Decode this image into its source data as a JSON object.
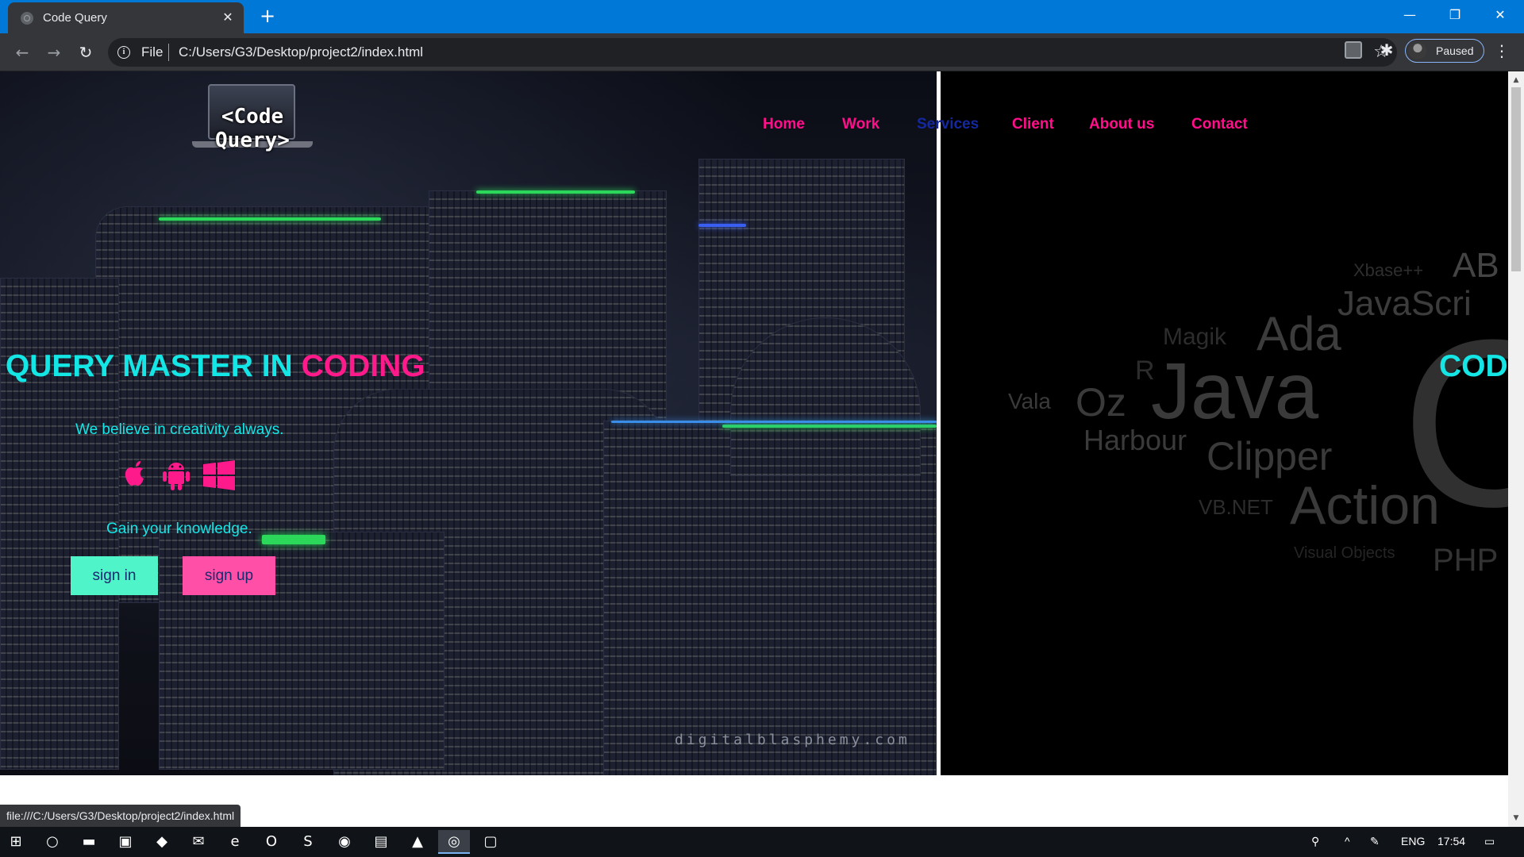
{
  "browser": {
    "tab_title": "Code Query",
    "url_scheme": "File",
    "url": "C:/Users/G3/Desktop/project2/index.html",
    "profile_label": "Paused",
    "status_url": "file:///C:/Users/G3/Desktop/project2/index.html"
  },
  "site": {
    "logo_text": "<Code Query>",
    "nav": [
      "Home",
      "Work",
      "Services",
      "Client",
      "About us",
      "Contact"
    ],
    "headline_cyan": "E QUERY MASTER IN ",
    "headline_pink": "CODING",
    "headline_right": "COD",
    "tagline": "We believe in creativity always.",
    "platform_icons": [
      "apple-icon",
      "android-icon",
      "windows-icon"
    ],
    "knowledge": "Gain your knowledge.",
    "signin_label": "sign in",
    "signup_label": "sign up",
    "watermark": "digitalblasphemy.com",
    "word_cloud": [
      "AB",
      "Xbase++",
      "JavaScri",
      "Magik",
      "Ada",
      "R",
      "Java",
      "Vala",
      "Oz",
      "Harbour",
      "Clipper",
      "VB.NET",
      "Action",
      "Visual Objects",
      "PHP",
      "C"
    ]
  },
  "taskbar": {
    "lang": "ENG",
    "time": "17:54"
  },
  "colors": {
    "accent_pink": "#ff1a8c",
    "accent_cyan": "#14e6e6",
    "signin_bg": "#4ff5c8",
    "signup_bg": "#ff4fa6",
    "chrome_frame": "#0078d7"
  }
}
